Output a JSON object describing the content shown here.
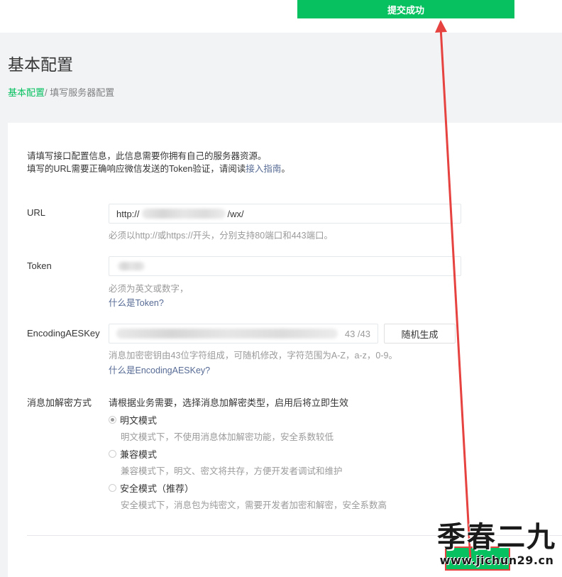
{
  "toast": {
    "text": "提交成功"
  },
  "header": {
    "title": "基本配置",
    "breadcrumb_link": "基本配置",
    "breadcrumb_sep": "/ ",
    "breadcrumb_current": "填写服务器配置"
  },
  "intro": {
    "line1": "请填写接口配置信息，此信息需要你拥有自己的服务器资源。",
    "line2_prefix": "填写的URL需要正确响应微信发送的Token验证，请阅读",
    "line2_link": "接入指南",
    "line2_suffix": "。"
  },
  "form": {
    "url": {
      "label": "URL",
      "value_prefix": "http://",
      "value_suffix": "/wx/",
      "hint": "必须以http://或https://开头，分别支持80端口和443端口。"
    },
    "token": {
      "label": "Token",
      "hint": "必须为英文或数字，",
      "help_link": "什么是Token?"
    },
    "aeskey": {
      "label": "EncodingAESKey",
      "counter": "43 /43",
      "random_button": "随机生成",
      "hint": "消息加密密钥由43位字符组成，可随机修改，字符范围为A-Z，a-z，0-9。",
      "help_link": "什么是EncodingAESKey?"
    },
    "encryption": {
      "label": "消息加解密方式",
      "description": "请根据业务需要，选择消息加解密类型，启用后将立即生效",
      "options": [
        {
          "label": "明文模式",
          "desc": "明文模式下，不使用消息体加解密功能，安全系数较低",
          "checked": true
        },
        {
          "label": "兼容模式",
          "desc": "兼容模式下，明文、密文将共存，方便开发者调试和维护",
          "checked": false
        },
        {
          "label": "安全模式（推荐）",
          "desc": "安全模式下，消息包为纯密文，需要开发者加密和解密，安全系数高",
          "checked": false
        }
      ]
    }
  },
  "watermark": {
    "big": "季春二九",
    "small": "www.jichun29.cn"
  },
  "colors": {
    "accent": "#07c160",
    "link": "#576b95",
    "annotation_arrow": "#e64340"
  }
}
